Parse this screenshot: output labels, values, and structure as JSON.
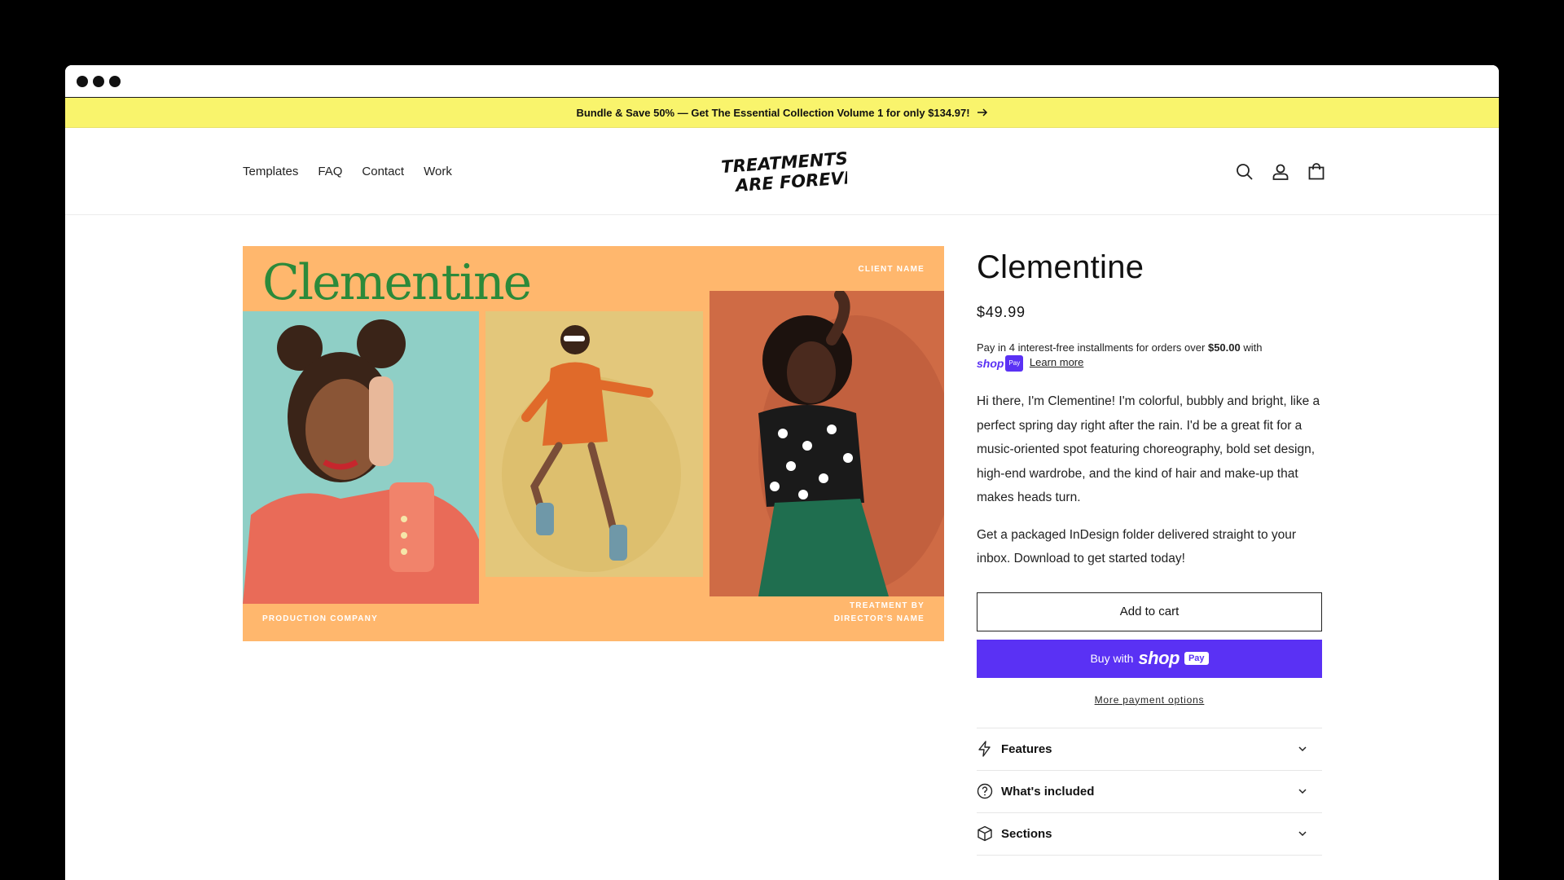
{
  "window": {
    "controls": [
      "dot",
      "dot",
      "dot"
    ]
  },
  "announcement": {
    "text": "Bundle & Save 50% — Get The Essential Collection Volume 1 for only $134.97!"
  },
  "nav": {
    "items": [
      "Templates",
      "FAQ",
      "Contact",
      "Work"
    ],
    "logo_text": [
      "TREATMENTS",
      "ARE FOREVER"
    ]
  },
  "header_icons": [
    "search-icon",
    "account-icon",
    "cart-icon"
  ],
  "gallery": {
    "title": "Clementine",
    "client_label": "CLIENT NAME",
    "production_label": "PRODUCTION COMPANY",
    "treatment_by": "TREATMENT BY",
    "director_label": "DIRECTOR'S NAME",
    "colors": {
      "background": "#ffb76d",
      "title": "#2c8a3a"
    }
  },
  "product": {
    "title": "Clementine",
    "price": "$49.99",
    "installments_prefix": "Pay in 4 interest-free installments for orders over",
    "installments_amount": "$50.00",
    "installments_suffix": "with",
    "shop_word": "shop",
    "shop_pay_badge": "Pay",
    "learn_more": "Learn more",
    "description": [
      "Hi there, I'm Clementine! I'm colorful, bubbly and bright, like a perfect spring day right after the rain. I'd be a great fit for a music-oriented spot featuring choreography, bold set design, high-end wardrobe, and the kind of hair and make-up that makes heads turn.",
      "Get a packaged InDesign folder delivered straight to your inbox. Download to get started today!"
    ],
    "add_to_cart": "Add to cart",
    "buy_with": "Buy with",
    "buy_shop_word": "shop",
    "buy_pay_badge": "Pay",
    "more_payment": "More payment options",
    "accordion": [
      {
        "label": "Features",
        "icon": "lightning-icon"
      },
      {
        "label": "What's included",
        "icon": "question-circle-icon"
      },
      {
        "label": "Sections",
        "icon": "box-icon"
      }
    ],
    "colors": {
      "shop_pay": "#5a31f4",
      "announcement": "#f9f46c"
    }
  }
}
